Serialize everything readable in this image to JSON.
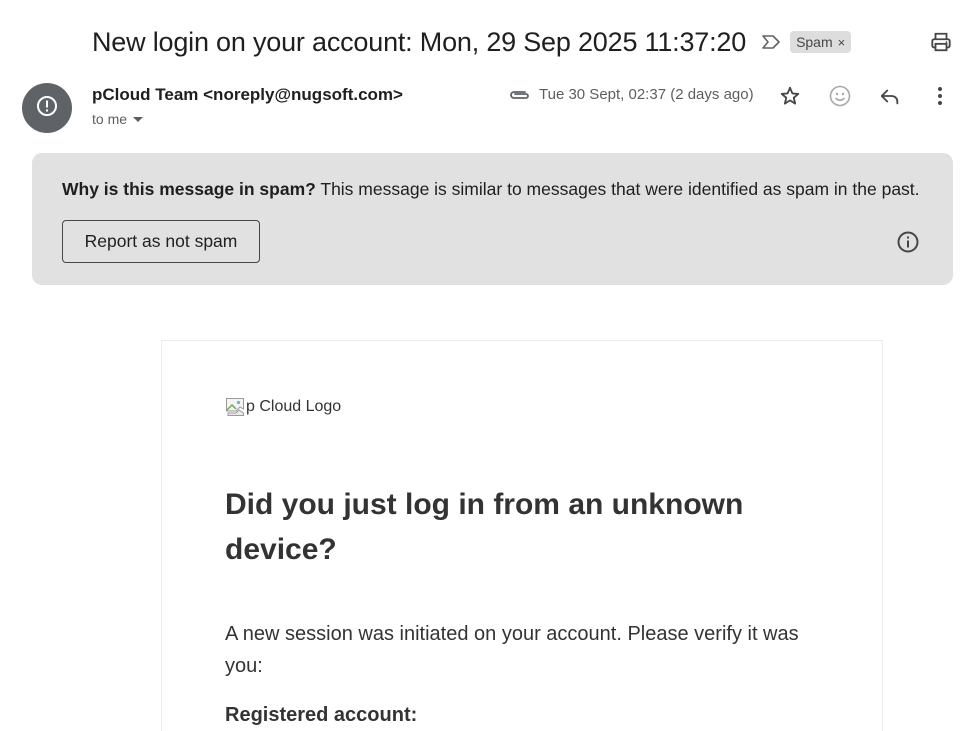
{
  "subject": "New login on your account: Mon, 29 Sep 2025 11:37:20",
  "labels": {
    "spam_chip": "Spam",
    "spam_chip_close": "×"
  },
  "sender": {
    "display": "pCloud Team <noreply@nugsoft.com>",
    "recipient": "to me"
  },
  "date": "Tue 30 Sept, 02:37 (2 days ago)",
  "spam_banner": {
    "question": "Why is this message in spam?",
    "explanation": " This message is similar to messages that were identified as spam in the past.",
    "button_label": "Report as not spam"
  },
  "email_body": {
    "logo_alt": "p Cloud Logo",
    "heading": "Did you just log in from an unknown device?",
    "paragraph": "A new session was initiated on your account. Please verify it was you:",
    "registered_label": "Registered account:"
  },
  "icons": {
    "importance": "label-importance-icon",
    "print": "print-icon",
    "avatar": "alert-icon",
    "attachment": "attachment-icon",
    "star": "star-icon",
    "emoji": "emoji-icon",
    "reply": "reply-icon",
    "more": "more-vert-icon",
    "info": "info-icon"
  },
  "colors": {
    "banner_bg": "#e1e1e1",
    "avatar_bg": "#5f6368",
    "chip_bg": "#dddddd",
    "body_text": "#333333"
  }
}
